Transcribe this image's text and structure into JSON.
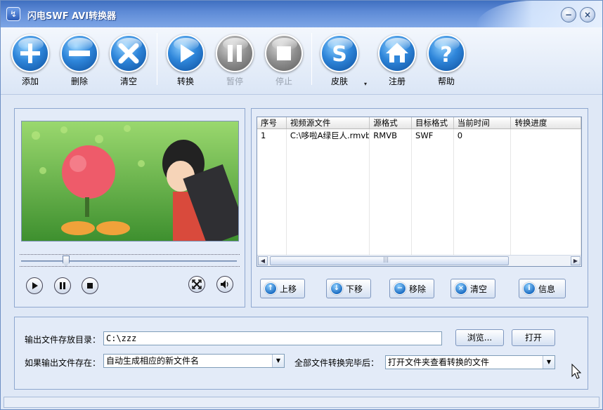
{
  "window": {
    "title": "闪电SWF AVI转换器",
    "minimize_glyph": "−",
    "close_glyph": "×"
  },
  "toolbar": {
    "items": [
      {
        "label": "添加",
        "icon": "plus-icon",
        "enabled": true
      },
      {
        "label": "删除",
        "icon": "minus-icon",
        "enabled": true
      },
      {
        "label": "清空",
        "icon": "x-icon",
        "enabled": true
      },
      {
        "label": "转换",
        "icon": "play-icon",
        "enabled": true
      },
      {
        "label": "暂停",
        "icon": "pause-icon",
        "enabled": false
      },
      {
        "label": "停止",
        "icon": "stop-icon",
        "enabled": false
      },
      {
        "label": "皮肤",
        "icon": "skin-s-icon",
        "enabled": true
      },
      {
        "label": "注册",
        "icon": "home-icon",
        "enabled": true
      },
      {
        "label": "帮助",
        "icon": "question-icon",
        "enabled": true
      }
    ],
    "skin_dropdown_glyph": "▾"
  },
  "player": {
    "seek_position": 0.2
  },
  "file_list": {
    "columns": [
      "序号",
      "视频源文件",
      "源格式",
      "目标格式",
      "当前时间",
      "转换进度"
    ],
    "rows": [
      [
        "1",
        "C:\\哆啦A绿巨人.rmvb",
        "RMVB",
        "SWF",
        "0",
        ""
      ]
    ],
    "scroll_left": "◀",
    "scroll_right": "▶",
    "scroll_grip": "|||"
  },
  "list_actions": {
    "up": "上移",
    "down": "下移",
    "remove": "移除",
    "clear": "清空",
    "info": "信息"
  },
  "settings": {
    "output_dir_label": "输出文件存放目录：",
    "output_dir_value": "C:\\zzz",
    "browse": "浏览...",
    "open": "打开",
    "if_exists_label": "如果输出文件存在：",
    "if_exists_value": "自动生成相应的新文件名",
    "after_all_label": "全部文件转换完毕后：",
    "after_all_value": "打开文件夹查看转换的文件",
    "dropdown_glyph": "▼"
  },
  "colors": {
    "accent": "#2f86da",
    "window_bg": "#dfe8f6",
    "title_bar": "#3f6fc0"
  }
}
